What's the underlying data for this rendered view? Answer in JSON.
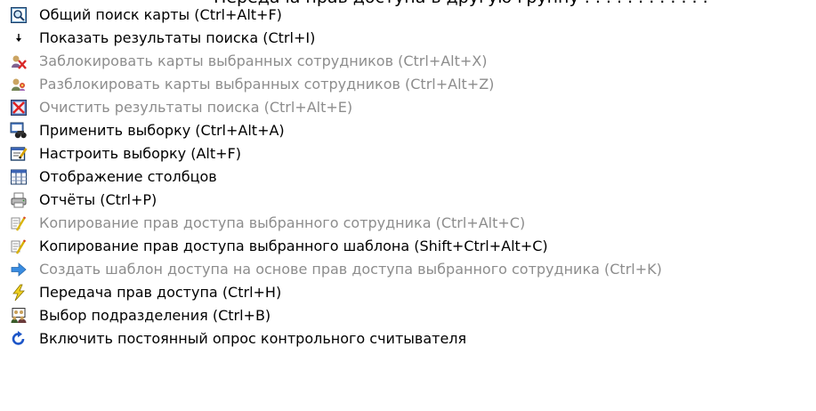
{
  "header": {
    "cut_text": "Передача прав доступа в другую группу . . . . . . . . . . . ."
  },
  "menu": {
    "items": [
      {
        "label": "Общий поиск карты (Ctrl+Alt+F)",
        "icon": "search-card-icon",
        "enabled": true
      },
      {
        "label": "Показать результаты поиска (Ctrl+I)",
        "icon": "arrow-down-small-icon",
        "enabled": true
      },
      {
        "label": "Заблокировать  карты выбранных сотрудников (Ctrl+Alt+X)",
        "icon": "block-cards-icon",
        "enabled": false
      },
      {
        "label": "Разблокировать карты выбранных сотрудников (Ctrl+Alt+Z)",
        "icon": "unblock-cards-icon",
        "enabled": false
      },
      {
        "label": "Очистить результаты поиска (Ctrl+Alt+E)",
        "icon": "clear-results-icon",
        "enabled": false
      },
      {
        "label": "Применить выборку (Ctrl+Alt+A)",
        "icon": "binoculars-icon",
        "enabled": true
      },
      {
        "label": "Настроить выборку (Alt+F)",
        "icon": "edit-filter-icon",
        "enabled": true
      },
      {
        "label": "Отображение столбцов",
        "icon": "columns-icon",
        "enabled": true
      },
      {
        "label": "Отчёты (Ctrl+P)",
        "icon": "printer-icon",
        "enabled": true
      },
      {
        "label": "Копирование прав доступа выбранного сотрудника (Ctrl+Alt+C)",
        "icon": "copy-rights-icon",
        "enabled": false
      },
      {
        "label": "Копирование прав доступа выбранного шаблона (Shift+Ctrl+Alt+C)",
        "icon": "copy-rights-icon",
        "enabled": true
      },
      {
        "label": "Создать шаблон доступа на основе прав доступа выбранного сотрудника (Ctrl+K)",
        "icon": "arrow-right-icon",
        "enabled": false
      },
      {
        "label": "Передача прав доступа (Ctrl+H)",
        "icon": "lightning-icon",
        "enabled": true
      },
      {
        "label": "Выбор подразделения (Ctrl+B)",
        "icon": "department-icon",
        "enabled": true
      },
      {
        "label": "Включить постоянный опрос контрольного считывателя",
        "icon": "refresh-icon",
        "enabled": true
      }
    ]
  }
}
